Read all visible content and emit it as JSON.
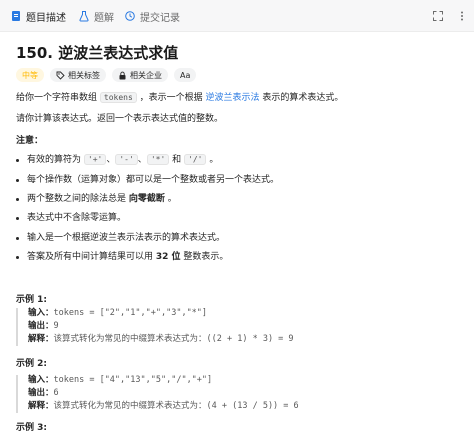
{
  "tabs": [
    {
      "label": "题目描述",
      "icon": "document-icon",
      "active": true
    },
    {
      "label": "题解",
      "icon": "flask-icon",
      "active": false
    },
    {
      "label": "提交记录",
      "icon": "history-icon",
      "active": false
    }
  ],
  "title": "150. 逆波兰表达式求值",
  "tags": {
    "difficulty": "中等",
    "related_tags": "相关标签",
    "related_companies": "相关企业",
    "font_size_label": "Aa"
  },
  "description": {
    "l1_a": "给你一个字符串数组 ",
    "l1_code": "tokens",
    "l1_b": " ，表示一个根据 ",
    "l1_link": "逆波兰表示法",
    "l1_c": " 表示的算术表达式。",
    "l2": "请你计算该表达式。返回一个表示表达式值的整数。"
  },
  "note_title": "注意：",
  "notes": {
    "n1_a": "有效的算符为 ",
    "n1_c1": "'+'",
    "n1_s1": "、",
    "n1_c2": "'-'",
    "n1_s2": "、",
    "n1_c3": "'*'",
    "n1_s3": " 和 ",
    "n1_c4": "'/'",
    "n1_s4": " 。",
    "n2": "每个操作数（运算对象）都可以是一个整数或者另一个表达式。",
    "n3_a": "两个整数之间的除法总是 ",
    "n3_b": "向零截断",
    "n3_c": " 。",
    "n4": "表达式中不含除零运算。",
    "n5": "输入是一个根据逆波兰表示法表示的算术表达式。",
    "n6_a": "答案及所有中间计算结果可以用 ",
    "n6_b": "32 位",
    "n6_c": " 整数表示。"
  },
  "examples": [
    {
      "title": "示例 1:",
      "input_label": "输入：",
      "input": "tokens = [\"2\",\"1\",\"+\",\"3\",\"*\"]",
      "output_label": "输出：",
      "output": "9",
      "explain_label": "解释：",
      "explain_text": "该算式转化为常见的中缀算术表达式为：",
      "explain_code": "((2 + 1) * 3) = 9"
    },
    {
      "title": "示例 2:",
      "input_label": "输入：",
      "input": "tokens = [\"4\",\"13\",\"5\",\"/\",\"+\"]",
      "output_label": "输出：",
      "output": "6",
      "explain_label": "解释：",
      "explain_text": "该算式转化为常见的中缀算术表达式为：",
      "explain_code": "(4 + (13 / 5)) = 6"
    },
    {
      "title": "示例 3:"
    }
  ],
  "colors": {
    "accent": "#2a7ae2",
    "difficulty": "#ffb800",
    "text": "#262626",
    "muted": "#595959"
  }
}
